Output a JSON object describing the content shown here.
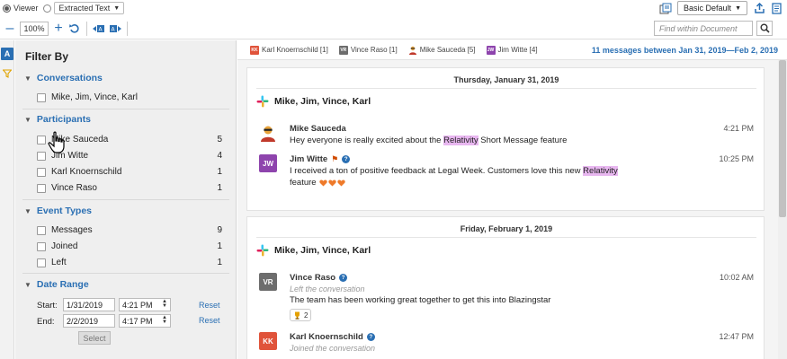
{
  "toolbar": {
    "viewer_label": "Viewer",
    "mode_select": "Extracted Text",
    "profile_select": "Basic Default",
    "zoom": "100%",
    "find_placeholder": "Find within Document"
  },
  "filter": {
    "title": "Filter By",
    "conversations": {
      "heading": "Conversations",
      "items": [
        {
          "label": "Mike, Jim, Vince, Karl"
        }
      ]
    },
    "participants": {
      "heading": "Participants",
      "items": [
        {
          "label": "Mike Sauceda",
          "count": "5"
        },
        {
          "label": "Jim Witte",
          "count": "4"
        },
        {
          "label": "Karl Knoernschild",
          "count": "1"
        },
        {
          "label": "Vince Raso",
          "count": "1"
        }
      ]
    },
    "event_types": {
      "heading": "Event Types",
      "items": [
        {
          "label": "Messages",
          "count": "9"
        },
        {
          "label": "Joined",
          "count": "1"
        },
        {
          "label": "Left",
          "count": "1"
        }
      ]
    },
    "date_range": {
      "heading": "Date Range",
      "start_label": "Start:",
      "start_date": "1/31/2019",
      "start_time": "4:21 PM",
      "end_label": "End:",
      "end_date": "2/2/2019",
      "end_time": "4:17 PM",
      "reset": "Reset",
      "select": "Select"
    }
  },
  "participant_bar": {
    "chips": [
      {
        "initials": "KK",
        "label": "Karl Knoernschild [1]",
        "color": "#e0533a"
      },
      {
        "initials": "VR",
        "label": "Vince Raso [1]",
        "color": "#6d6d6d"
      },
      {
        "initials": "",
        "label": "Mike Sauceda [5]",
        "color": "#e8a33a"
      },
      {
        "initials": "JW",
        "label": "Jim Witte [4]",
        "color": "#8e44ad"
      }
    ],
    "summary": "11 messages between Jan 31, 2019—Feb 2, 2019"
  },
  "days": [
    {
      "date": "Thursday, January 31, 2019",
      "group": "Mike, Jim, Vince, Karl",
      "messages": [
        {
          "name": "Mike Sauceda",
          "time": "4:21 PM",
          "text_pre": "Hey everyone is really excited about the ",
          "text_hl": "Relativity",
          "text_post": " Short Message feature"
        },
        {
          "name": "Jim Witte",
          "initials": "JW",
          "time": "10:25 PM",
          "text_pre": "I received a ton of positive feedback at Legal Week.  Customers love this new ",
          "text_hl": "Relativity",
          "line2": "feature"
        }
      ]
    },
    {
      "date": "Friday, February 1, 2019",
      "group": "Mike, Jim, Vince, Karl",
      "messages": [
        {
          "name": "Vince Raso",
          "initials": "VR",
          "time": "10:02 AM",
          "sub": "Left the conversation",
          "text": "The team has been working great together to get this into Blazingstar",
          "reaction_count": "2"
        },
        {
          "name": "Karl Knoernschild",
          "initials": "KK",
          "time": "12:47 PM",
          "sub": "Joined the conversation"
        }
      ]
    }
  ],
  "colors": {
    "accent": "#2a6fb3",
    "highlight": "#e8b7f0",
    "heart": "#ee7a2a"
  }
}
